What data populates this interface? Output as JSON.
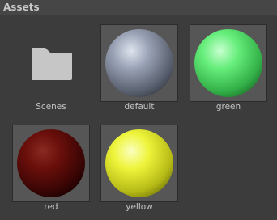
{
  "header": {
    "title": "Assets"
  },
  "assets": [
    {
      "name": "Scenes",
      "kind": "folder",
      "icon": "folder-icon",
      "color": "#c6c6c6"
    },
    {
      "name": "default",
      "kind": "material",
      "icon": "sphere-icon",
      "color": "#8e97aa"
    },
    {
      "name": "green",
      "kind": "material",
      "icon": "sphere-icon",
      "color": "#5ee873"
    },
    {
      "name": "red",
      "kind": "material",
      "icon": "sphere-icon",
      "color": "#6e0f0c"
    },
    {
      "name": "yellow",
      "kind": "material",
      "icon": "sphere-icon",
      "color": "#ecf233"
    }
  ]
}
